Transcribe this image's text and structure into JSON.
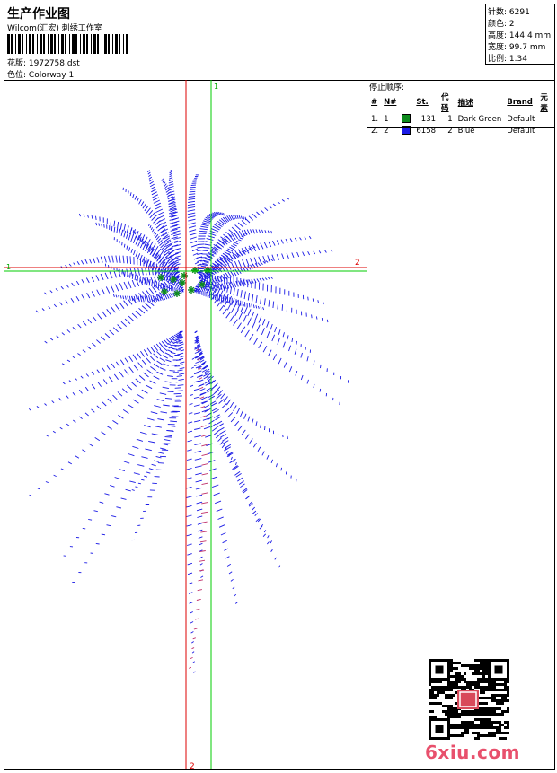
{
  "header": {
    "title": "生产作业图",
    "company": "Wilcom(汇宏) 刺绣工作室",
    "design_label": "花版:",
    "design_value": "1972758.dst",
    "colorway_label": "色位:",
    "colorway_value": "Colorway 1"
  },
  "stats": {
    "stitches_label": "针数:",
    "stitches_value": "6291",
    "colors_label": "颜色:",
    "colors_value": "2",
    "height_label": "高度:",
    "height_value": "144.4 mm",
    "width_label": "宽度:",
    "width_value": "99.7 mm",
    "scale_label": "比例:",
    "scale_value": "1.34"
  },
  "stops": {
    "title": "停止顺序:",
    "headers": [
      "#",
      "N#",
      "St.",
      "代码",
      "描述",
      "Brand",
      "元素"
    ],
    "rows": [
      {
        "num": "1.",
        "needle": "1",
        "color": "#0c8a1c",
        "stitches": "131",
        "code": "1",
        "desc": "Dark Green",
        "brand": "Default"
      },
      {
        "num": "2.",
        "needle": "2",
        "color": "#1a1ae6",
        "stitches": "6158",
        "code": "2",
        "desc": "Blue",
        "brand": "Default"
      }
    ]
  },
  "crosshair": {
    "vertical_green_label": "1",
    "horizontal_green_label": "1",
    "horizontal_red_label": "2",
    "vertical_red_label": "2",
    "green_color": "#00cc00",
    "red_color": "#dd0000"
  },
  "embroidery": {
    "petal_color": "#1a1ae6",
    "center_color": "#0c8a1c",
    "stem_color": "#c0306a"
  },
  "watermark": {
    "text": "6xiu.com",
    "color": "#e8506c"
  }
}
